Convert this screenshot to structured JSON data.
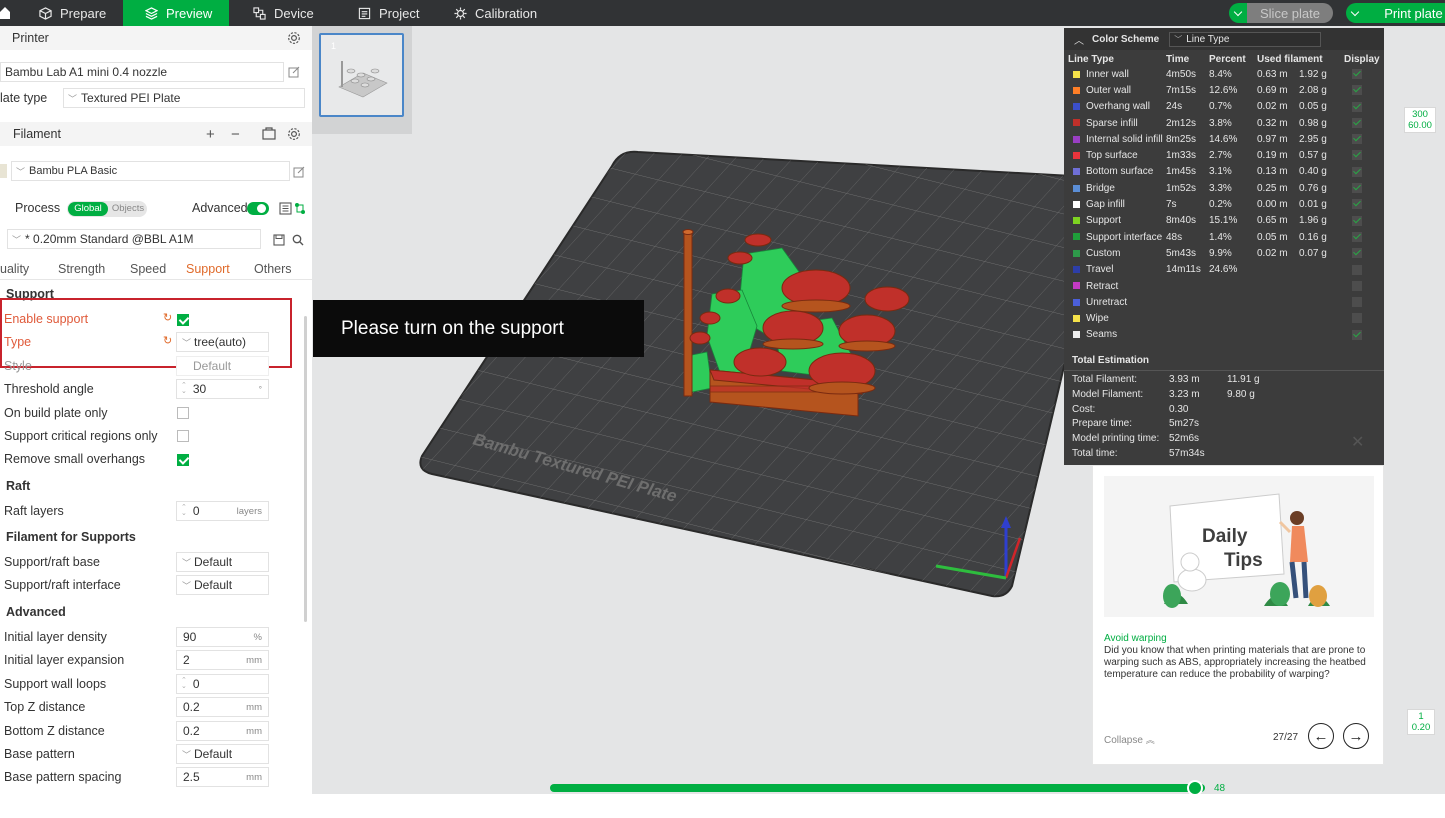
{
  "topbar": {
    "tabs": [
      {
        "label": "Prepare",
        "icon": "cube-icon"
      },
      {
        "label": "Preview",
        "icon": "layers-icon"
      },
      {
        "label": "Device",
        "icon": "device-icon"
      },
      {
        "label": "Project",
        "icon": "project-icon"
      },
      {
        "label": "Calibration",
        "icon": "calibration-icon"
      }
    ],
    "active_tab": "Preview",
    "slice_label": "Slice plate",
    "print_label": "Print plate"
  },
  "sidebar": {
    "printer": {
      "title": "Printer",
      "model": "Bambu Lab A1 mini 0.4 nozzle",
      "plate_type_label": "late type",
      "plate_type_value": "Textured PEI Plate"
    },
    "filament": {
      "title": "Filament",
      "value": "Bambu PLA Basic"
    },
    "process": {
      "title": "Process",
      "toggle_global": "Global",
      "toggle_objects": "Objects",
      "advanced_label": "Advanced",
      "preset": "* 0.20mm Standard @BBL A1M",
      "tabs": [
        "uality",
        "Strength",
        "Speed",
        "Support",
        "Others"
      ],
      "active_tab": "Support"
    },
    "support": {
      "title": "Support",
      "enable_label": "Enable support",
      "enable_checked": true,
      "type_label": "Type",
      "type_value": "tree(auto)",
      "style_label": "Style",
      "style_value": "Default",
      "threshold_label": "Threshold angle",
      "threshold_value": "30",
      "build_plate_label": "On build plate only",
      "critical_label": "Support critical regions only",
      "remove_small_label": "Remove small overhangs"
    },
    "raft": {
      "title": "Raft",
      "layers_label": "Raft layers",
      "layers_value": "0",
      "layers_unit": "layers"
    },
    "filament_supports": {
      "title": "Filament for Supports",
      "base_label": "Support/raft base",
      "base_value": "Default",
      "interface_label": "Support/raft interface",
      "interface_value": "Default"
    },
    "advanced": {
      "title": "Advanced",
      "rows": [
        {
          "label": "Initial layer density",
          "value": "90",
          "unit": "%"
        },
        {
          "label": "Initial layer expansion",
          "value": "2",
          "unit": "mm"
        },
        {
          "label": "Support wall loops",
          "value": "0",
          "unit": ""
        },
        {
          "label": "Top Z distance",
          "value": "0.2",
          "unit": "mm"
        },
        {
          "label": "Bottom Z distance",
          "value": "0.2",
          "unit": "mm"
        },
        {
          "label": "Base pattern",
          "value": "Default",
          "unit": ""
        },
        {
          "label": "Base pattern spacing",
          "value": "2.5",
          "unit": "mm"
        }
      ]
    }
  },
  "viewport": {
    "plate_number": "1",
    "bed_text": "Bambu Textured PEI Plate",
    "callout": "Please turn on the support"
  },
  "legend": {
    "title": "Color Scheme",
    "scheme": "Line Type",
    "columns": [
      "Line Type",
      "Time",
      "Percent",
      "Used filament",
      "Display"
    ],
    "rows": [
      {
        "name": "Inner wall",
        "color": "#f5e24a",
        "time": "4m50s",
        "pct": "8.4%",
        "len": "0.63 m",
        "wt": "1.92 g",
        "on": true
      },
      {
        "name": "Outer wall",
        "color": "#ff7f27",
        "time": "7m15s",
        "pct": "12.6%",
        "len": "0.69 m",
        "wt": "2.08 g",
        "on": true
      },
      {
        "name": "Overhang wall",
        "color": "#3b4fc9",
        "time": "24s",
        "pct": "0.7%",
        "len": "0.02 m",
        "wt": "0.05 g",
        "on": true
      },
      {
        "name": "Sparse infill",
        "color": "#c0302a",
        "time": "2m12s",
        "pct": "3.8%",
        "len": "0.32 m",
        "wt": "0.98 g",
        "on": true
      },
      {
        "name": "Internal solid infill",
        "color": "#9a3fc4",
        "time": "8m25s",
        "pct": "14.6%",
        "len": "0.97 m",
        "wt": "2.95 g",
        "on": true
      },
      {
        "name": "Top surface",
        "color": "#e8343c",
        "time": "1m33s",
        "pct": "2.7%",
        "len": "0.19 m",
        "wt": "0.57 g",
        "on": true
      },
      {
        "name": "Bottom surface",
        "color": "#6f6fd6",
        "time": "1m45s",
        "pct": "3.1%",
        "len": "0.13 m",
        "wt": "0.40 g",
        "on": true
      },
      {
        "name": "Bridge",
        "color": "#5b8ed6",
        "time": "1m52s",
        "pct": "3.3%",
        "len": "0.25 m",
        "wt": "0.76 g",
        "on": true
      },
      {
        "name": "Gap infill",
        "color": "#ffffff",
        "time": "7s",
        "pct": "0.2%",
        "len": "0.00 m",
        "wt": "0.01 g",
        "on": true
      },
      {
        "name": "Support",
        "color": "#7ed321",
        "time": "8m40s",
        "pct": "15.1%",
        "len": "0.65 m",
        "wt": "1.96 g",
        "on": true
      },
      {
        "name": "Support interface",
        "color": "#1f9e3a",
        "time": "48s",
        "pct": "1.4%",
        "len": "0.05 m",
        "wt": "0.16 g",
        "on": true
      },
      {
        "name": "Custom",
        "color": "#2e9a4a",
        "time": "5m43s",
        "pct": "9.9%",
        "len": "0.02 m",
        "wt": "0.07 g",
        "on": true
      },
      {
        "name": "Travel",
        "color": "#2d3ea8",
        "time": "14m11s",
        "pct": "24.6%",
        "len": "",
        "wt": "",
        "on": false
      },
      {
        "name": "Retract",
        "color": "#c43ac4",
        "time": "",
        "pct": "",
        "len": "",
        "wt": "",
        "on": false
      },
      {
        "name": "Unretract",
        "color": "#4b5fd9",
        "time": "",
        "pct": "",
        "len": "",
        "wt": "",
        "on": false
      },
      {
        "name": "Wipe",
        "color": "#f5e24a",
        "time": "",
        "pct": "",
        "len": "",
        "wt": "",
        "on": false
      },
      {
        "name": "Seams",
        "color": "#eeeeee",
        "time": "",
        "pct": "",
        "len": "",
        "wt": "",
        "on": true
      }
    ],
    "total_title": "Total Estimation",
    "totals": [
      {
        "k": "Total Filament:",
        "v1": "3.93 m",
        "v2": "11.91 g"
      },
      {
        "k": "Model Filament:",
        "v1": "3.23 m",
        "v2": "9.80 g"
      },
      {
        "k": "Cost:",
        "v1": "0.30",
        "v2": ""
      },
      {
        "k": "Prepare time:",
        "v1": "5m27s",
        "v2": ""
      },
      {
        "k": "Model printing time:",
        "v1": "52m6s",
        "v2": ""
      },
      {
        "k": "Total time:",
        "v1": "57m34s",
        "v2": ""
      }
    ]
  },
  "tips": {
    "image_line1": "Daily",
    "image_line2": "Tips",
    "title": "Avoid warping",
    "body": "Did you know that when printing materials that are prone to warping such as ABS, appropriately increasing the heatbed temperature can reduce the probability of warping?",
    "collapse": "Collapse",
    "page": "27/27"
  },
  "layers": {
    "top_layer": "300",
    "top_height": "60.00",
    "bottom_layer": "1",
    "bottom_height": "0.20",
    "horizontal_value": "48"
  },
  "colors": {
    "accent": "#00ae42",
    "topbar": "#313335",
    "highlight": "#c8232c",
    "support_red": "#c0302a",
    "support_green": "#2ecc5a",
    "wall_orange": "#b5541e"
  }
}
